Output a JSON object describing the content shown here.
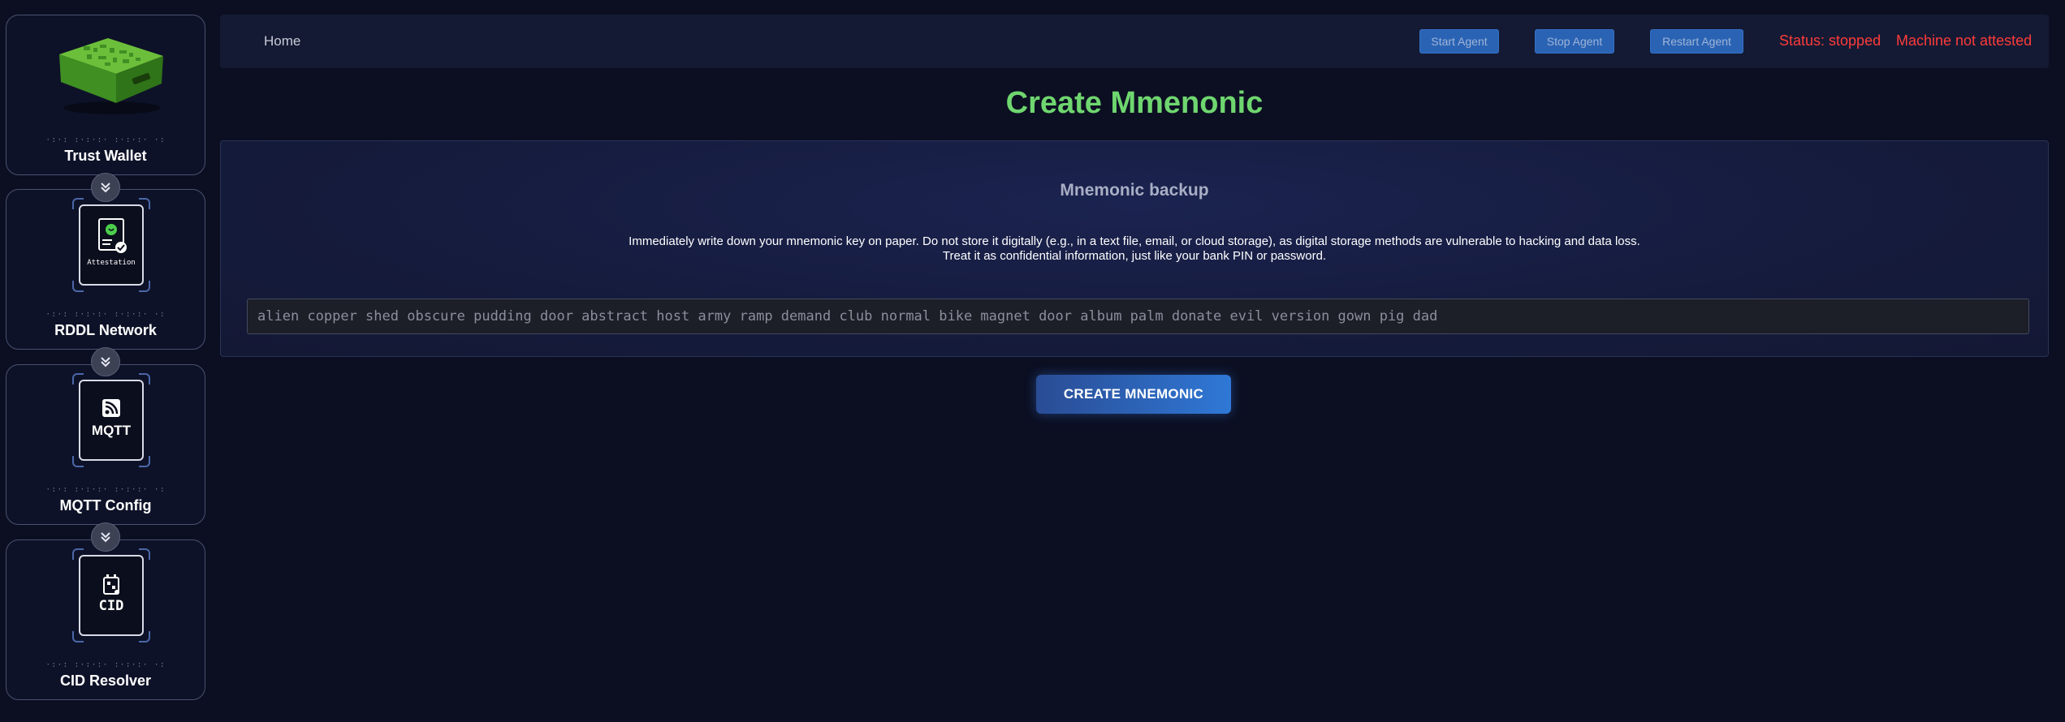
{
  "sidebar": {
    "items": [
      {
        "label": "Trust Wallet",
        "dots": "·:·: :·:·:· :·:·:· ·:"
      },
      {
        "label": "RDDL Network",
        "dots": "·:·: :·:·:· :·:·:· ·:",
        "tile_text": "Attestation"
      },
      {
        "label": "MQTT Config",
        "dots": "·:·: :·:·:· :·:·:· ·:",
        "tile_text": "MQTT"
      },
      {
        "label": "CID Resolver",
        "dots": "·:·: :·:·:· :·:·:· ·:",
        "tile_text": "CID"
      }
    ]
  },
  "topbar": {
    "home": "Home",
    "start_agent": "Start Agent",
    "stop_agent": "Stop Agent",
    "restart_agent": "Restart Agent",
    "status": "Status: stopped",
    "attestation": "Machine not attested"
  },
  "main": {
    "title": "Create Mmenonic",
    "panel_title": "Mnemonic backup",
    "notice_line1": "Immediately write down your mnemonic key on paper. Do not store it digitally (e.g., in a text file, email, or cloud storage), as digital storage methods are vulnerable to hacking and data loss.",
    "notice_line2": "Treat it as confidential information, just like your bank PIN or password.",
    "mnemonic": "alien copper shed obscure pudding door abstract host army ramp demand club normal bike magnet door album palm donate evil version gown pig dad",
    "create_button": "CREATE MNEMONIC"
  },
  "colors": {
    "background": "#0c0f22",
    "title_green": "#6fd66f",
    "status_red": "#ff3b3b",
    "button_blue": "#2f78d6"
  }
}
